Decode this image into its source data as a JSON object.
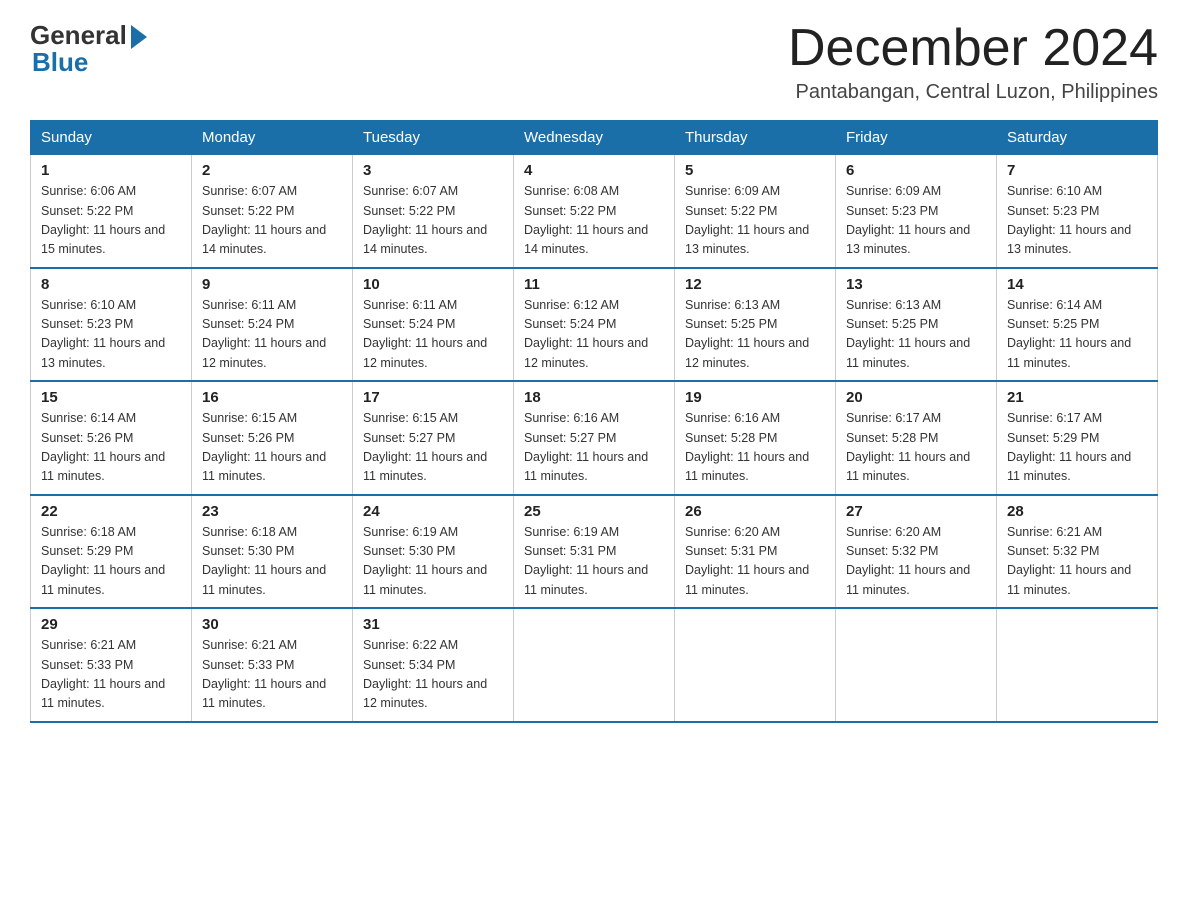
{
  "header": {
    "logo_general": "General",
    "logo_blue": "Blue",
    "month_title": "December 2024",
    "location": "Pantabangan, Central Luzon, Philippines"
  },
  "weekdays": [
    "Sunday",
    "Monday",
    "Tuesday",
    "Wednesday",
    "Thursday",
    "Friday",
    "Saturday"
  ],
  "weeks": [
    [
      {
        "day": "1",
        "sunrise": "6:06 AM",
        "sunset": "5:22 PM",
        "daylight": "11 hours and 15 minutes."
      },
      {
        "day": "2",
        "sunrise": "6:07 AM",
        "sunset": "5:22 PM",
        "daylight": "11 hours and 14 minutes."
      },
      {
        "day": "3",
        "sunrise": "6:07 AM",
        "sunset": "5:22 PM",
        "daylight": "11 hours and 14 minutes."
      },
      {
        "day": "4",
        "sunrise": "6:08 AM",
        "sunset": "5:22 PM",
        "daylight": "11 hours and 14 minutes."
      },
      {
        "day": "5",
        "sunrise": "6:09 AM",
        "sunset": "5:22 PM",
        "daylight": "11 hours and 13 minutes."
      },
      {
        "day": "6",
        "sunrise": "6:09 AM",
        "sunset": "5:23 PM",
        "daylight": "11 hours and 13 minutes."
      },
      {
        "day": "7",
        "sunrise": "6:10 AM",
        "sunset": "5:23 PM",
        "daylight": "11 hours and 13 minutes."
      }
    ],
    [
      {
        "day": "8",
        "sunrise": "6:10 AM",
        "sunset": "5:23 PM",
        "daylight": "11 hours and 13 minutes."
      },
      {
        "day": "9",
        "sunrise": "6:11 AM",
        "sunset": "5:24 PM",
        "daylight": "11 hours and 12 minutes."
      },
      {
        "day": "10",
        "sunrise": "6:11 AM",
        "sunset": "5:24 PM",
        "daylight": "11 hours and 12 minutes."
      },
      {
        "day": "11",
        "sunrise": "6:12 AM",
        "sunset": "5:24 PM",
        "daylight": "11 hours and 12 minutes."
      },
      {
        "day": "12",
        "sunrise": "6:13 AM",
        "sunset": "5:25 PM",
        "daylight": "11 hours and 12 minutes."
      },
      {
        "day": "13",
        "sunrise": "6:13 AM",
        "sunset": "5:25 PM",
        "daylight": "11 hours and 11 minutes."
      },
      {
        "day": "14",
        "sunrise": "6:14 AM",
        "sunset": "5:25 PM",
        "daylight": "11 hours and 11 minutes."
      }
    ],
    [
      {
        "day": "15",
        "sunrise": "6:14 AM",
        "sunset": "5:26 PM",
        "daylight": "11 hours and 11 minutes."
      },
      {
        "day": "16",
        "sunrise": "6:15 AM",
        "sunset": "5:26 PM",
        "daylight": "11 hours and 11 minutes."
      },
      {
        "day": "17",
        "sunrise": "6:15 AM",
        "sunset": "5:27 PM",
        "daylight": "11 hours and 11 minutes."
      },
      {
        "day": "18",
        "sunrise": "6:16 AM",
        "sunset": "5:27 PM",
        "daylight": "11 hours and 11 minutes."
      },
      {
        "day": "19",
        "sunrise": "6:16 AM",
        "sunset": "5:28 PM",
        "daylight": "11 hours and 11 minutes."
      },
      {
        "day": "20",
        "sunrise": "6:17 AM",
        "sunset": "5:28 PM",
        "daylight": "11 hours and 11 minutes."
      },
      {
        "day": "21",
        "sunrise": "6:17 AM",
        "sunset": "5:29 PM",
        "daylight": "11 hours and 11 minutes."
      }
    ],
    [
      {
        "day": "22",
        "sunrise": "6:18 AM",
        "sunset": "5:29 PM",
        "daylight": "11 hours and 11 minutes."
      },
      {
        "day": "23",
        "sunrise": "6:18 AM",
        "sunset": "5:30 PM",
        "daylight": "11 hours and 11 minutes."
      },
      {
        "day": "24",
        "sunrise": "6:19 AM",
        "sunset": "5:30 PM",
        "daylight": "11 hours and 11 minutes."
      },
      {
        "day": "25",
        "sunrise": "6:19 AM",
        "sunset": "5:31 PM",
        "daylight": "11 hours and 11 minutes."
      },
      {
        "day": "26",
        "sunrise": "6:20 AM",
        "sunset": "5:31 PM",
        "daylight": "11 hours and 11 minutes."
      },
      {
        "day": "27",
        "sunrise": "6:20 AM",
        "sunset": "5:32 PM",
        "daylight": "11 hours and 11 minutes."
      },
      {
        "day": "28",
        "sunrise": "6:21 AM",
        "sunset": "5:32 PM",
        "daylight": "11 hours and 11 minutes."
      }
    ],
    [
      {
        "day": "29",
        "sunrise": "6:21 AM",
        "sunset": "5:33 PM",
        "daylight": "11 hours and 11 minutes."
      },
      {
        "day": "30",
        "sunrise": "6:21 AM",
        "sunset": "5:33 PM",
        "daylight": "11 hours and 11 minutes."
      },
      {
        "day": "31",
        "sunrise": "6:22 AM",
        "sunset": "5:34 PM",
        "daylight": "11 hours and 12 minutes."
      },
      null,
      null,
      null,
      null
    ]
  ]
}
